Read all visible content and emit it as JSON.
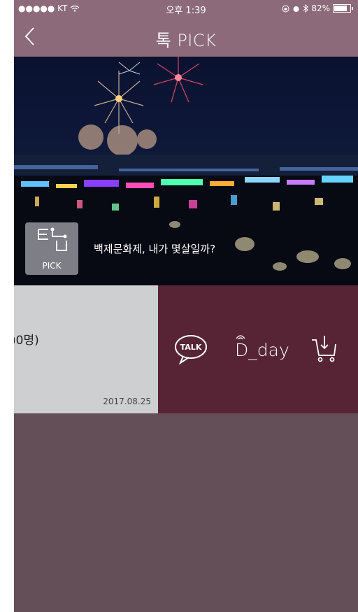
{
  "status_bar": {
    "carrier": "●●●●● KT",
    "time": "오후 1:39",
    "battery": "82%"
  },
  "header": {
    "title": "톡 PICK"
  },
  "hero": {
    "badge_label": "PICK",
    "caption": "백제문화제, 내가 몇살일까?"
  },
  "card": {
    "text": ")0명)",
    "date": "2017.08.25"
  },
  "actions": {
    "talk_label": "TALK",
    "dday_label": "D_day"
  },
  "colors": {
    "header_bg": "#8c6a79",
    "action_bg": "#562434",
    "page_bg": "#644e58",
    "card_bg": "#cdcfd1"
  }
}
